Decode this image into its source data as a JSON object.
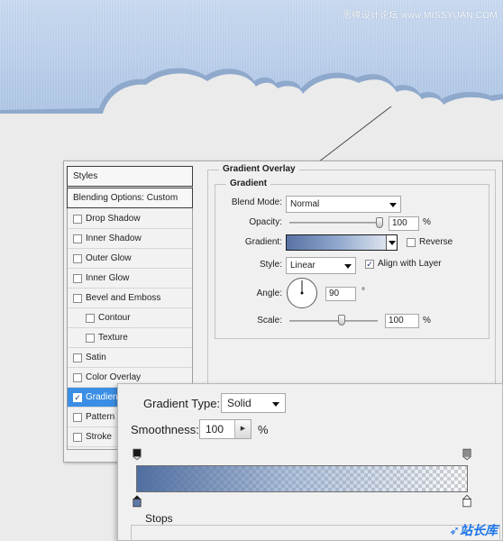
{
  "watermark": {
    "top": "思缘设计论坛 www.MISSYUAN.COM",
    "logo_part1": "站长",
    "logo_part2": "库"
  },
  "styles_panel": {
    "header": "Styles",
    "blending": "Blending Options: Custom",
    "items": [
      {
        "label": "Drop Shadow",
        "checked": false
      },
      {
        "label": "Inner Shadow",
        "checked": false
      },
      {
        "label": "Outer Glow",
        "checked": false
      },
      {
        "label": "Inner Glow",
        "checked": false
      },
      {
        "label": "Bevel and Emboss",
        "checked": false
      },
      {
        "label": "Contour",
        "checked": false
      },
      {
        "label": "Texture",
        "checked": false
      },
      {
        "label": "Satin",
        "checked": false
      },
      {
        "label": "Color Overlay",
        "checked": false
      },
      {
        "label": "Gradient Overlay",
        "checked": true
      },
      {
        "label": "Pattern Overlay",
        "checked": false
      },
      {
        "label": "Stroke",
        "checked": false
      }
    ],
    "visible_labels": {
      "gradient_overlay": "Gradien",
      "pattern_overlay": "Pattern C"
    }
  },
  "overlay": {
    "section_title": "Gradient Overlay",
    "group_title": "Gradient",
    "blend_mode_label": "Blend Mode:",
    "blend_mode_value": "Normal",
    "opacity_label": "Opacity:",
    "opacity_value": "100",
    "percent": "%",
    "gradient_label": "Gradient:",
    "reverse_label": "Reverse",
    "reverse_checked": false,
    "style_label": "Style:",
    "style_value": "Linear",
    "align_label": "Align with Layer",
    "align_checked": true,
    "angle_label": "Angle:",
    "angle_value": "90",
    "degree": "°",
    "scale_label": "Scale:",
    "scale_value": "100",
    "opacity_fraction": 1.0,
    "scale_fraction": 0.6
  },
  "gradient_editor": {
    "type_label": "Gradient Type:",
    "type_value": "Solid",
    "smoothness_label": "Smoothness:",
    "smoothness_value": "100",
    "percent": "%",
    "stops_label": "Stops"
  },
  "colors": {
    "sky_top": "#b7cde8",
    "sky_bottom": "#d5e2f2",
    "gradient_start": "#506ea0",
    "selection": "#3b8ee5"
  }
}
